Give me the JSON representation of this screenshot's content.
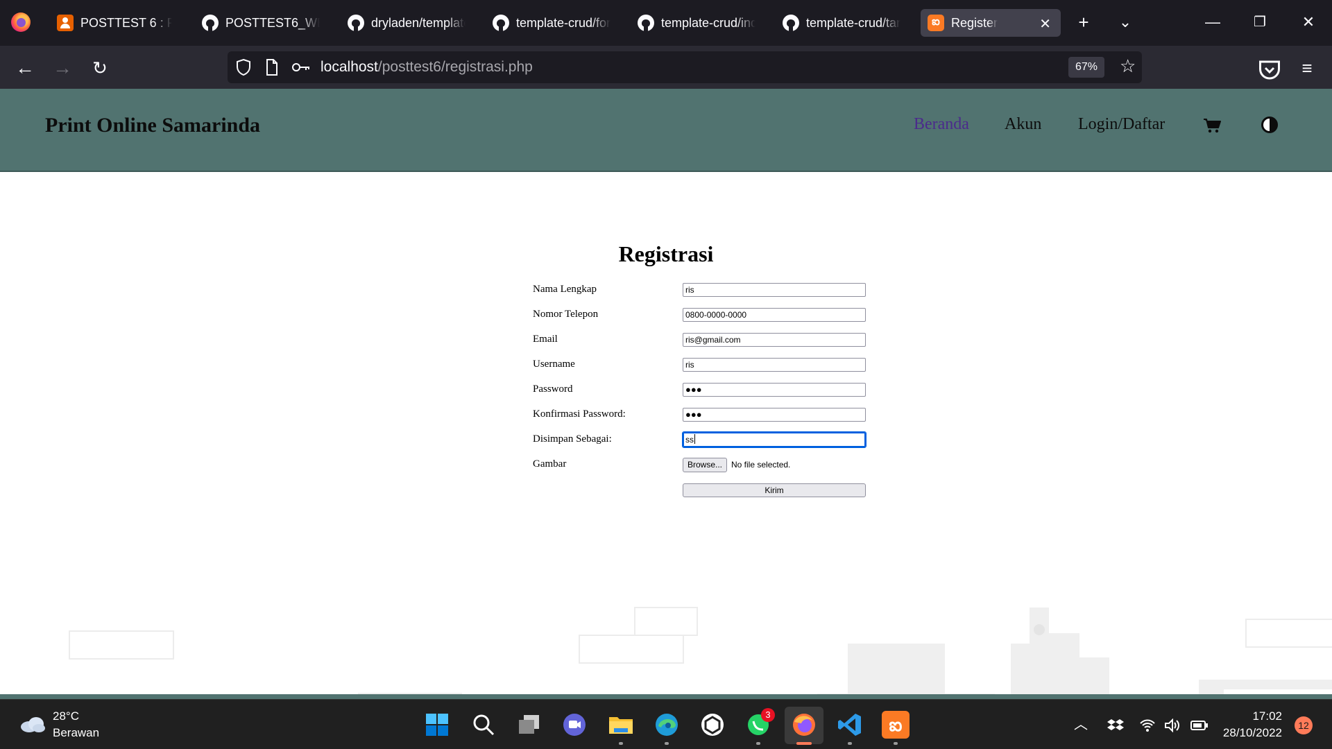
{
  "browser": {
    "tabs": [
      {
        "title": "POSTTEST 6 : PHP",
        "icon": "orange-person-icon"
      },
      {
        "title": "POSTTEST6_WEB/",
        "icon": "github-icon"
      },
      {
        "title": "dryladen/template",
        "icon": "github-icon"
      },
      {
        "title": "template-crud/for",
        "icon": "github-icon"
      },
      {
        "title": "template-crud/ind",
        "icon": "github-icon"
      },
      {
        "title": "template-crud/tan",
        "icon": "github-icon"
      },
      {
        "title": "Register",
        "icon": "xampp-icon",
        "active": true
      }
    ],
    "url_host": "localhost",
    "url_path": "/posttest6/registrasi.php",
    "zoom": "67%"
  },
  "site": {
    "brand": "Print Online Samarinda",
    "menu": [
      "Beranda",
      "Akun",
      "Login/Daftar"
    ],
    "current_color": "#4b2a8c",
    "header_color": "#517370"
  },
  "form": {
    "title": "Registrasi",
    "fields": [
      {
        "label": "Nama Lengkap",
        "value": "ris"
      },
      {
        "label": "Nomor Telepon",
        "value": "0800-0000-0000"
      },
      {
        "label": "Email",
        "value": "ris@gmail.com"
      },
      {
        "label": "Username",
        "value": "ris"
      },
      {
        "label": "Password",
        "value": "●●●"
      },
      {
        "label": "Konfirmasi Password:",
        "value": "●●●"
      },
      {
        "label": "Disimpan Sebagai:",
        "value": "ss"
      }
    ],
    "file_label": "Gambar",
    "file_button": "Browse...",
    "file_status": "No file selected.",
    "submit": "Kirim"
  },
  "taskbar": {
    "temperature": "28°C",
    "condition": "Berawan",
    "whatsapp_badge": "3",
    "time": "17:02",
    "date": "28/10/2022",
    "notifications": "12"
  }
}
